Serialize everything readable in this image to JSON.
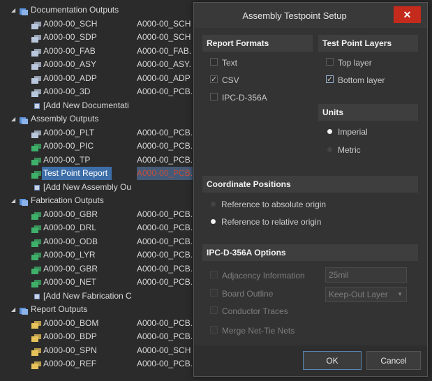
{
  "colors": {
    "accent": "#3d6ea8",
    "close": "#c42b1c",
    "highlight_file": "#c0503c"
  },
  "tree": {
    "rows": [
      {
        "type": "group",
        "name": "Documentation Outputs",
        "icon": "folder-doc-icon"
      },
      {
        "type": "file",
        "name": "A000-00_SCH",
        "file": "A000-00_SCH",
        "icon": "doc-output-icon"
      },
      {
        "type": "file",
        "name": "A000-00_SDP",
        "file": "A000-00_SCH",
        "icon": "doc-output-icon"
      },
      {
        "type": "file",
        "name": "A000-00_FAB",
        "file": "A000-00_FAB.",
        "icon": "doc-output-icon"
      },
      {
        "type": "file",
        "name": "A000-00_ASY",
        "file": "A000-00_ASY.",
        "icon": "doc-output-icon"
      },
      {
        "type": "file",
        "name": "A000-00_ADP",
        "file": "A000-00_ADP",
        "icon": "doc-output-icon"
      },
      {
        "type": "file",
        "name": "A000-00_3D",
        "file": "A000-00_PCB.",
        "icon": "doc-output-icon"
      },
      {
        "type": "add",
        "name": "[Add New Documentati"
      },
      {
        "type": "group",
        "name": "Assembly Outputs",
        "icon": "folder-asm-icon"
      },
      {
        "type": "file",
        "name": "A000-00_PLT",
        "file": "A000-00_PCB.",
        "icon": "doc-output-icon"
      },
      {
        "type": "file",
        "name": "A000-00_PIC",
        "file": "A000-00_PCB.",
        "icon": "fab-output-icon"
      },
      {
        "type": "file",
        "name": "A000-00_TP",
        "file": "A000-00_PCB.",
        "icon": "fab-output-icon"
      },
      {
        "type": "file",
        "name": "Test Point Report",
        "file": "A000-00_PCB.",
        "icon": "fab-output-icon",
        "selected": true
      },
      {
        "type": "add",
        "name": "[Add New Assembly Ou"
      },
      {
        "type": "group",
        "name": "Fabrication Outputs",
        "icon": "folder-fab-icon"
      },
      {
        "type": "file",
        "name": "A000-00_GBR",
        "file": "A000-00_PCB.",
        "icon": "fab-output-icon"
      },
      {
        "type": "file",
        "name": "A000-00_DRL",
        "file": "A000-00_PCB.",
        "icon": "fab-output-icon"
      },
      {
        "type": "file",
        "name": "A000-00_ODB",
        "file": "A000-00_PCB.",
        "icon": "fab-output-icon"
      },
      {
        "type": "file",
        "name": "A000-00_LYR",
        "file": "A000-00_PCB.",
        "icon": "fab-output-icon"
      },
      {
        "type": "file",
        "name": "A000-00_GBR",
        "file": "A000-00_PCB.",
        "icon": "fab-output-icon"
      },
      {
        "type": "file",
        "name": "A000-00_NET",
        "file": "A000-00_PCB.",
        "icon": "fab-output-icon"
      },
      {
        "type": "add",
        "name": "[Add New Fabrication C"
      },
      {
        "type": "group",
        "name": "Report Outputs",
        "icon": "folder-report-icon"
      },
      {
        "type": "file",
        "name": "A000-00_BOM",
        "file": "A000-00_PCB.",
        "icon": "report-output-icon"
      },
      {
        "type": "file",
        "name": "A000-00_BDP",
        "file": "A000-00_PCB.",
        "icon": "report-output-icon"
      },
      {
        "type": "file",
        "name": "A000-00_SPN",
        "file": "A000-00_SCH",
        "icon": "report-output-icon"
      },
      {
        "type": "file",
        "name": "A000-00_REF",
        "file": "A000-00_PCB.",
        "icon": "report-output-icon"
      }
    ]
  },
  "dialog": {
    "title": "Assembly Testpoint Setup",
    "close_label": "✕",
    "report_formats": {
      "header": "Report Formats",
      "text": "Text",
      "csv": "CSV",
      "ipc": "IPC-D-356A"
    },
    "test_point_layers": {
      "header": "Test Point Layers",
      "top": "Top layer",
      "bottom": "Bottom layer"
    },
    "units": {
      "header": "Units",
      "imperial": "Imperial",
      "metric": "Metric"
    },
    "coordinates": {
      "header": "Coordinate Positions",
      "absolute": "Reference to absolute origin",
      "relative": "Reference to relative origin"
    },
    "ipc_options": {
      "header": "IPC-D-356A Options",
      "adjacency": "Adjacency Information",
      "adjacency_value": "25mil",
      "board_outline": "Board Outline",
      "board_outline_value": "Keep-Out Layer",
      "conductor": "Conductor Traces",
      "merge": "Merge Net-Tie Nets"
    },
    "ok": "OK",
    "cancel": "Cancel"
  }
}
